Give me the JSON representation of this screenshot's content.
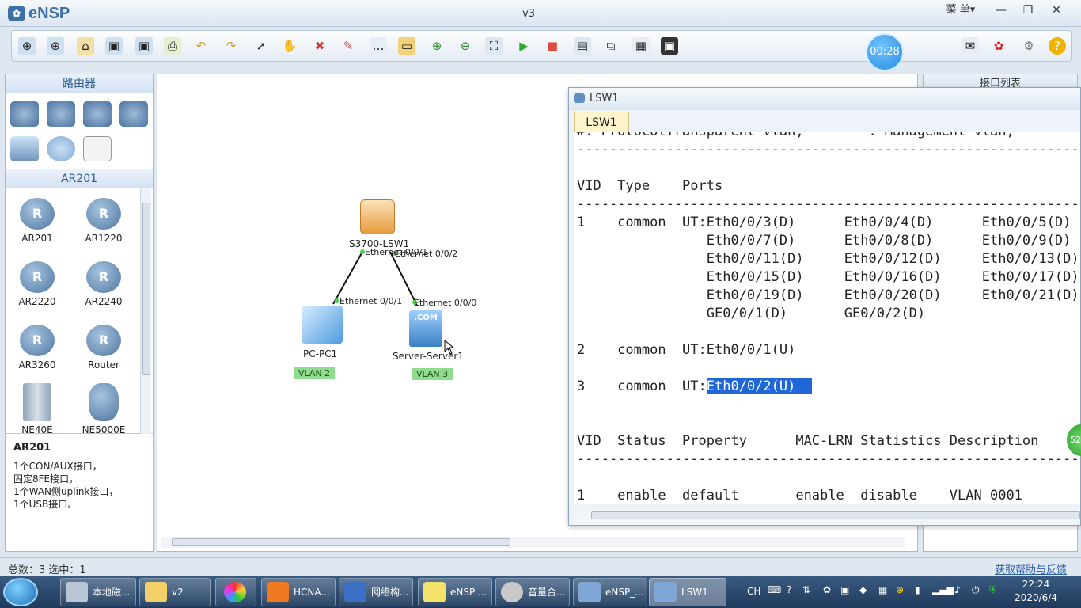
{
  "app": {
    "logo": "eNSP",
    "window_title": "v3",
    "menu_label": "菜 单▾",
    "min": "—",
    "max": "❐",
    "close": "✕"
  },
  "timer": "00:28",
  "left_panel": {
    "category_header": "路由器",
    "subcategory_header": "AR201",
    "devices": [
      {
        "label": "AR201"
      },
      {
        "label": "AR1220"
      },
      {
        "label": "AR2220"
      },
      {
        "label": "AR2240"
      },
      {
        "label": "AR3260"
      },
      {
        "label": "Router"
      },
      {
        "label": "NE40E"
      },
      {
        "label": "NE5000E"
      }
    ],
    "description": {
      "title": "AR201",
      "lines": [
        "1个CON/AUX接口，",
        "固定8FE接口，",
        "1个WAN侧uplink接口，",
        "1个USB接口。"
      ]
    }
  },
  "topology": {
    "switch": {
      "label": "S3700-LSW1",
      "port1": "Ethernet 0/0/1",
      "port2": "Ethernet 0/0/2"
    },
    "pc": {
      "label": "PC-PC1",
      "port": "Ethernet 0/0/1",
      "vlan": "VLAN 2"
    },
    "server": {
      "label": "Server-Server1",
      "port": "Ethernet 0/0/0",
      "vlan": "VLAN 3",
      "badge": ".COM"
    }
  },
  "right_panel": {
    "title": "接口列表"
  },
  "console": {
    "title": "LSW1",
    "tab": "LSW1",
    "lines": [
      "#: ProtocolTransparent-vlan;       *: Management-vlan;",
      "--------------------------------------------------------------------",
      "",
      "VID  Type    Ports",
      "--------------------------------------------------------------------",
      "1    common  UT:Eth0/0/3(D)      Eth0/0/4(D)      Eth0/0/5(D)",
      "                Eth0/0/7(D)      Eth0/0/8(D)      Eth0/0/9(D)",
      "                Eth0/0/11(D)     Eth0/0/12(D)     Eth0/0/13(D)",
      "                Eth0/0/15(D)     Eth0/0/16(D)     Eth0/0/17(D)",
      "                Eth0/0/19(D)     Eth0/0/20(D)     Eth0/0/21(D)",
      "                GE0/0/1(D)       GE0/0/2(D)",
      "",
      "2    common  UT:Eth0/0/1(U)",
      "",
      "3    common  UT:",
      "",
      "",
      "VID  Status  Property      MAC-LRN Statistics Description",
      "--------------------------------------------------------------------",
      "",
      "1    enable  default       enable  disable    VLAN 0001"
    ],
    "highlight_text": "Eth0/0/2(U)  "
  },
  "green_badge": "52",
  "status": {
    "left": "总数：3  选中：1",
    "help": "获取帮助与反馈"
  },
  "taskbar": {
    "items": [
      {
        "label": "本地磁..."
      },
      {
        "label": "v2"
      },
      {
        "label": ""
      },
      {
        "label": "HCNA..."
      },
      {
        "label": "网络构..."
      },
      {
        "label": "eNSP ..."
      },
      {
        "label": "音量合..."
      },
      {
        "label": "eNSP_..."
      },
      {
        "label": "LSW1"
      }
    ],
    "ime": "CH",
    "time": "22:24",
    "date": "2020/6/4"
  },
  "colors": {
    "accent": "#3d6fa8",
    "highlight": "#1f67d8",
    "vlan": "#8fdc8f"
  }
}
